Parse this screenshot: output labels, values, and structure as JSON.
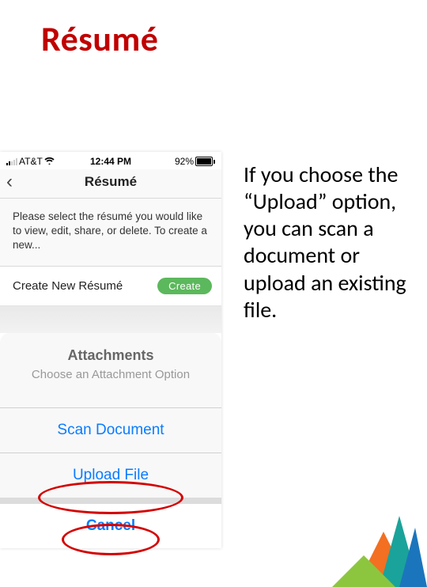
{
  "slide": {
    "title": "Résumé",
    "caption": "If you choose the “Upload” option, you can scan a document or upload an existing file."
  },
  "phone": {
    "status": {
      "carrier": "AT&T",
      "time": "12:44 PM",
      "battery_percent": "92%"
    },
    "nav": {
      "title": "Résumé"
    },
    "instruction": "Please select the résumé you would like to view, edit, share, or delete. To create a new...",
    "create_row": {
      "label": "Create New Résumé",
      "button": "Create"
    },
    "action_sheet": {
      "title": "Attachments",
      "subtitle": "Choose an Attachment Option",
      "options": {
        "scan": "Scan Document",
        "upload": "Upload File"
      },
      "cancel": "Cancel"
    }
  },
  "colors": {
    "title_red": "#c00000",
    "highlight_ring": "#d40000",
    "ios_blue": "#0a7cff",
    "create_green": "#5cb85c",
    "art": {
      "orange": "#f36f21",
      "teal": "#1aa39a",
      "green": "#8cc63f",
      "blue": "#1b75bc"
    }
  }
}
